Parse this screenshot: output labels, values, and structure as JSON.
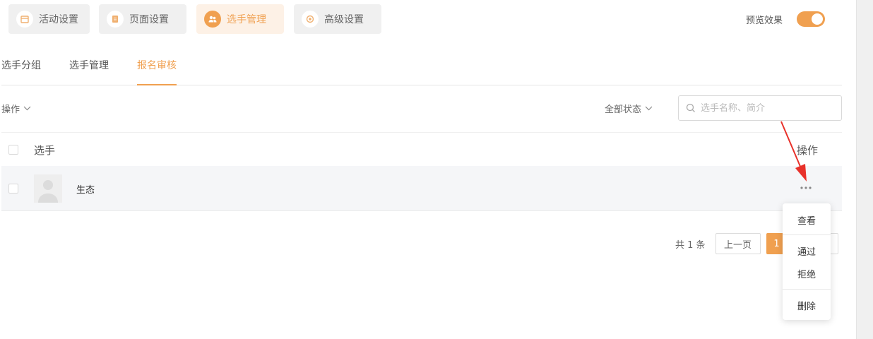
{
  "top_tabs": [
    {
      "label": "活动设置",
      "icon": "calendar-icon"
    },
    {
      "label": "页面设置",
      "icon": "page-icon"
    },
    {
      "label": "选手管理",
      "icon": "users-icon",
      "active": true
    },
    {
      "label": "高级设置",
      "icon": "settings-icon"
    }
  ],
  "preview": {
    "label": "预览效果",
    "enabled": true
  },
  "sub_tabs": [
    {
      "label": "选手分组"
    },
    {
      "label": "选手管理"
    },
    {
      "label": "报名审核",
      "active": true
    }
  ],
  "toolbar": {
    "operations_label": "操作",
    "status_filter_label": "全部状态",
    "search_placeholder": "选手名称、简介"
  },
  "table": {
    "headers": {
      "player": "选手",
      "actions": "操作"
    },
    "rows": [
      {
        "name": "生态"
      }
    ]
  },
  "pagination": {
    "total_text": "共 1 条",
    "prev_label": "上一页",
    "current_page": "1"
  },
  "action_menu": {
    "view": "查看",
    "approve": "通过",
    "reject": "拒绝",
    "delete": "删除"
  },
  "colors": {
    "accent": "#f0a050",
    "arrow": "#e8312a"
  }
}
